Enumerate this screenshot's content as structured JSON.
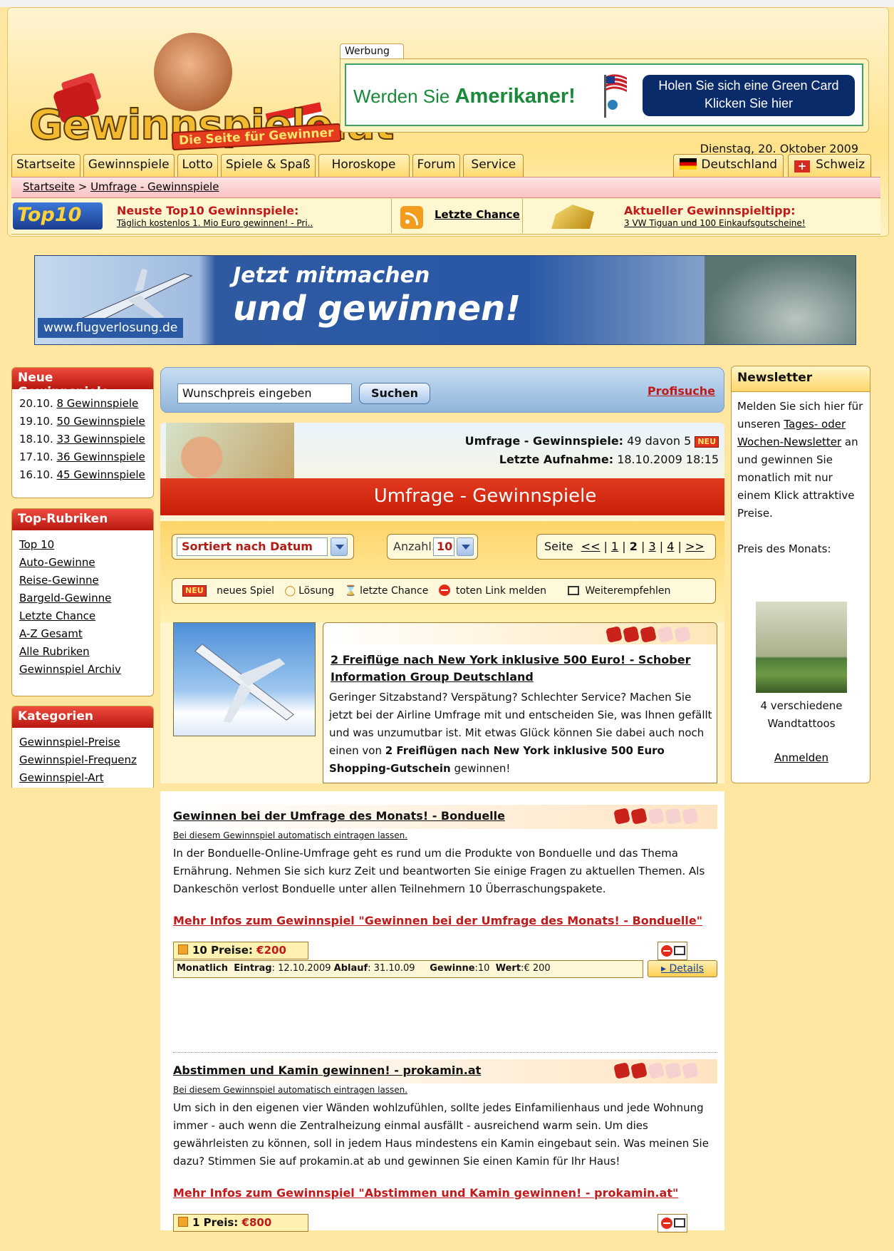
{
  "header": {
    "logo_text": "Gewinnspiele.at",
    "logo_tagline": "Die Seite für Gewinner",
    "ad_tab": "Werbung",
    "ad_left_pre": "Werden Sie ",
    "ad_left_bold": "Amerikaner!",
    "ad_right_l1": "Holen Sie sich eine Green Card",
    "ad_right_l2": "Klicken Sie hier",
    "date": "Dienstag, 20. Oktober 2009"
  },
  "nav": {
    "tabs": [
      "Startseite",
      "Gewinnspiele",
      "Lotto",
      "Spiele & Spaß",
      "Horoskope",
      "Forum",
      "Service"
    ],
    "right": [
      "Deutschland",
      "Schweiz"
    ]
  },
  "breadcrumb": {
    "home": "Startseite",
    "sep": " > ",
    "current": "Umfrage - Gewinnspiele"
  },
  "ticker": {
    "top10_logo": "Top10",
    "t1_title": "Neuste Top10 Gewinnspiele:",
    "t1_sub": "Täglich kostenlos 1. Mio Euro gewinnen! - Pri..",
    "t2": "Letzte Chance",
    "t3_title": "Aktueller Gewinnspieltipp:",
    "t3_sub": "3 VW Tiguan und 100 Einkaufsgutscheine!"
  },
  "banner": {
    "url": "www.flugverlosung.de",
    "line1": "Jetzt mitmachen",
    "line2": "und gewinnen!"
  },
  "left": {
    "neue": {
      "title": "Neue Gewinnspiele",
      "items": [
        {
          "date": "20.10.",
          "link": "8 Gewinnspiele"
        },
        {
          "date": "19.10.",
          "link": "50 Gewinnspiele"
        },
        {
          "date": "18.10.",
          "link": "33 Gewinnspiele"
        },
        {
          "date": "17.10.",
          "link": "36 Gewinnspiele"
        },
        {
          "date": "16.10.",
          "link": "45 Gewinnspiele"
        }
      ]
    },
    "rubriken": {
      "title": "Top-Rubriken",
      "items": [
        "Top 10",
        "Auto-Gewinne",
        "Reise-Gewinne",
        "Bargeld-Gewinne",
        "Letzte Chance",
        "A-Z Gesamt",
        "Alle Rubriken",
        "Gewinnspiel Archiv"
      ]
    },
    "kategorien": {
      "title": "Kategorien",
      "items": [
        "Gewinnspiel-Preise",
        "Gewinnspiel-Frequenz",
        "Gewinnspiel-Art"
      ]
    }
  },
  "search": {
    "placeholder": "Wunschpreis eingeben",
    "button": "Suchen",
    "profi": "Profisuche"
  },
  "section": {
    "count_label": "Umfrage - Gewinnspiele:",
    "count_value": "49 davon 5",
    "new_badge": "NEU",
    "last_label": "Letzte Aufnahme:",
    "last_value": "18.10.2009 18:15",
    "title": "Umfrage - Gewinnspiele"
  },
  "sort": {
    "sorted_by": "Sortiert nach Datum",
    "anzahl_label": "Anzahl:",
    "anzahl_value": "10",
    "seite_label": "Seite",
    "pages": [
      "<<",
      "1",
      "2",
      "3",
      "4",
      ">>"
    ]
  },
  "legend": {
    "neu": "neues Spiel",
    "loesung": "Lösung",
    "letzte": "letzte Chance",
    "toten": "toten Link melden",
    "weiter": "Weiterempfehlen"
  },
  "featured": {
    "title": "2 Freiflüge nach New York inklusive 500 Euro! - Schober Information Group Deutschland",
    "desc_plain": "Geringer Sitzabstand? Verspätung? Schlechter Service? Machen Sie jetzt bei der Airline Umfrage mit und entscheiden Sie, was Ihnen gefällt und was unzumutbar ist. Mit etwas Glück können Sie dabei auch noch einen von ",
    "desc_bold": "2 Freiflügen nach New York inklusive 500 Euro Shopping-Gutschein",
    "desc_end": " gewinnen!",
    "rating": 3
  },
  "newsletter": {
    "title": "Newsletter",
    "t1": "Melden Sie sich hier für unseren ",
    "link1": "Tages- oder Wochen-Newsletter",
    "t2": " an und gewinnen Sie monatlich mit nur einem Klick attraktive Preise.",
    "preis_label": "Preis des Monats:",
    "preis_caption": "4 verschiedene Wandtattoos",
    "anmelden": "Anmelden"
  },
  "entries": [
    {
      "title": "Gewinnen bei der Umfrage des Monats! - Bonduelle",
      "auto": "Bei diesem Gewinnspiel automatisch eintragen lassen.",
      "desc": "In der Bonduelle-Online-Umfrage geht es rund um die Produkte von Bonduelle und das Thema Ernährung. Nehmen Sie sich kurz Zeit und beantworten Sie einige Fragen zu aktuellen Themen. Als Dankeschön verlost Bonduelle unter allen Teilnehmern 10 Überraschungspakete.",
      "more": "Mehr Infos zum Gewinnspiel \"Gewinnen bei der Umfrage des Monats! - Bonduelle\"",
      "prize_label": "10 Preise:",
      "prize_value": "€200",
      "freq": "Monatlich",
      "eintrag": "12.10.2009",
      "ablauf": "31.10.09",
      "gewinne": "10",
      "wert": "€ 200",
      "details": "Details",
      "rating": 2
    },
    {
      "title": "Abstimmen und Kamin gewinnen! - prokamin.at",
      "auto": "Bei diesem Gewinnspiel automatisch eintragen lassen.",
      "desc": "Um sich in den eigenen vier Wänden wohlzufühlen, sollte jedes Einfamilienhaus und jede Wohnung immer - auch wenn die Zentralheizung einmal ausfällt - ausreichend warm sein. Um dies gewährleisten zu können, soll in jedem Haus mindestens ein Kamin eingebaut sein. Was meinen Sie dazu? Stimmen Sie auf prokamin.at ab und gewinnen Sie einen Kamin für Ihr Haus!",
      "more": "Mehr Infos zum Gewinnspiel \"Abstimmen und Kamin gewinnen! - prokamin.at\"",
      "prize_label": "1 Preis:",
      "prize_value": "€800",
      "rating": 2
    }
  ],
  "labels": {
    "eintrag": "Eintrag",
    "ablauf": "Ablauf",
    "gewinne": "Gewinne",
    "wert": "Wert"
  }
}
